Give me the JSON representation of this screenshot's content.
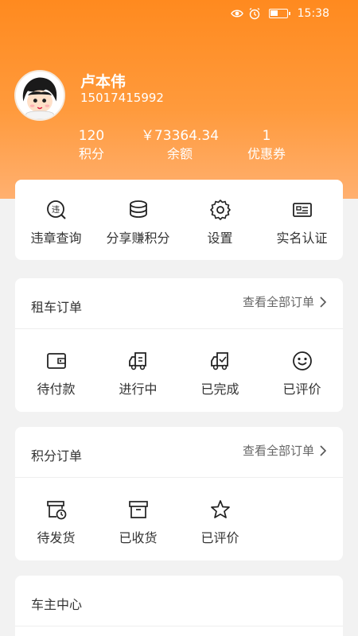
{
  "status_bar": {
    "time": "15:38"
  },
  "profile": {
    "name": "卢本伟",
    "phone": "15017415992",
    "stats": [
      {
        "value": "120",
        "label": "积分"
      },
      {
        "value": "￥73364.34",
        "label": "余额"
      },
      {
        "value": "1",
        "label": "优惠券"
      }
    ]
  },
  "quick_actions": [
    {
      "label": "违章查询",
      "icon": "violation-search-icon"
    },
    {
      "label": "分享赚积分",
      "icon": "coins-icon"
    },
    {
      "label": "设置",
      "icon": "gear-icon"
    },
    {
      "label": "实名认证",
      "icon": "id-card-icon"
    }
  ],
  "rental_orders": {
    "title": "租车订单",
    "view_all": "查看全部订单",
    "items": [
      {
        "label": "待付款",
        "icon": "wallet-icon"
      },
      {
        "label": "进行中",
        "icon": "truck-icon"
      },
      {
        "label": "已完成",
        "icon": "truck-check-icon"
      },
      {
        "label": "已评价",
        "icon": "smile-icon"
      }
    ]
  },
  "points_orders": {
    "title": "积分订单",
    "view_all": "查看全部订单",
    "items": [
      {
        "label": "待发货",
        "icon": "box-clock-icon"
      },
      {
        "label": "已收货",
        "icon": "package-icon"
      },
      {
        "label": "已评价",
        "icon": "star-icon"
      }
    ]
  },
  "owner_center": {
    "title": "车主中心"
  },
  "colors": {
    "accent": "#ff8a1f",
    "card_bg": "#ffffff",
    "page_bg": "#f2f2f2"
  }
}
